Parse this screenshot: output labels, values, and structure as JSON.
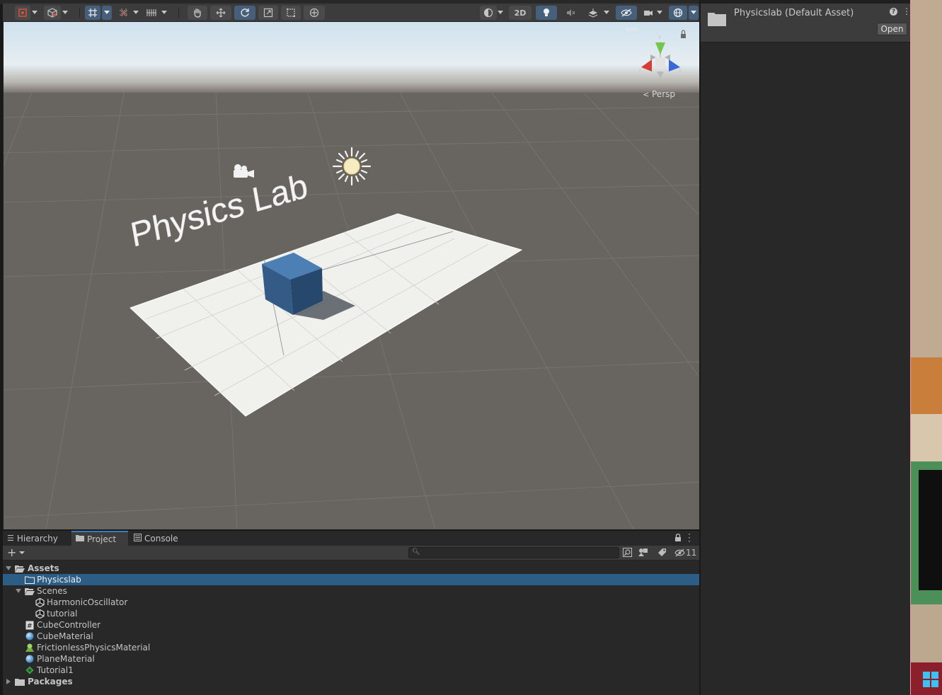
{
  "scene": {
    "title_text": "Physics Lab",
    "persp_label": "Persp",
    "toolbar": {
      "toggle_2d_label": "2D"
    }
  },
  "bottom_panel": {
    "tabs": [
      {
        "label": "Hierarchy",
        "icon": "hierarchy-icon",
        "active": false
      },
      {
        "label": "Project",
        "icon": "folder-icon",
        "active": true
      },
      {
        "label": "Console",
        "icon": "console-icon",
        "active": false
      }
    ],
    "hidden_count": "11",
    "search": {
      "placeholder": ""
    },
    "tree": [
      {
        "label": "Assets",
        "icon": "folder-open-icon",
        "depth": 0,
        "expand": "down",
        "bold": true,
        "selected": false
      },
      {
        "label": "Physicslab",
        "icon": "folder-outline-icon",
        "depth": 1,
        "expand": "none",
        "bold": false,
        "selected": true
      },
      {
        "label": "Scenes",
        "icon": "folder-open-icon",
        "depth": 1,
        "expand": "down",
        "bold": false,
        "selected": false
      },
      {
        "label": "HarmonicOscillator",
        "icon": "unity-scene-icon",
        "depth": 2,
        "expand": "none",
        "bold": false,
        "selected": false
      },
      {
        "label": "tutorial",
        "icon": "unity-scene-icon",
        "depth": 2,
        "expand": "none",
        "bold": false,
        "selected": false
      },
      {
        "label": "CubeController",
        "icon": "csharp-script-icon",
        "depth": 1,
        "expand": "none",
        "bold": false,
        "selected": false
      },
      {
        "label": "CubeMaterial",
        "icon": "material-sphere-icon",
        "depth": 1,
        "expand": "none",
        "bold": false,
        "selected": false
      },
      {
        "label": "FrictionlessPhysicsMaterial",
        "icon": "physics-material-icon",
        "depth": 1,
        "expand": "none",
        "bold": false,
        "selected": false
      },
      {
        "label": "PlaneMaterial",
        "icon": "material-sphere-icon",
        "depth": 1,
        "expand": "none",
        "bold": false,
        "selected": false
      },
      {
        "label": "Tutorial1",
        "icon": "tutorial-diamond-icon",
        "depth": 1,
        "expand": "none",
        "bold": false,
        "selected": false
      },
      {
        "label": "Packages",
        "icon": "folder-icon",
        "depth": 0,
        "expand": "right",
        "bold": true,
        "selected": false
      }
    ]
  },
  "inspector": {
    "title": "Physicslab (Default Asset)",
    "open_button": "Open"
  },
  "colors": {
    "selection": "#2c5d87",
    "accent": "#3a79bb",
    "panel": "#282828",
    "toolbar": "#3c3c3c",
    "ground": "#686460",
    "sky": "#cfe1ee"
  }
}
